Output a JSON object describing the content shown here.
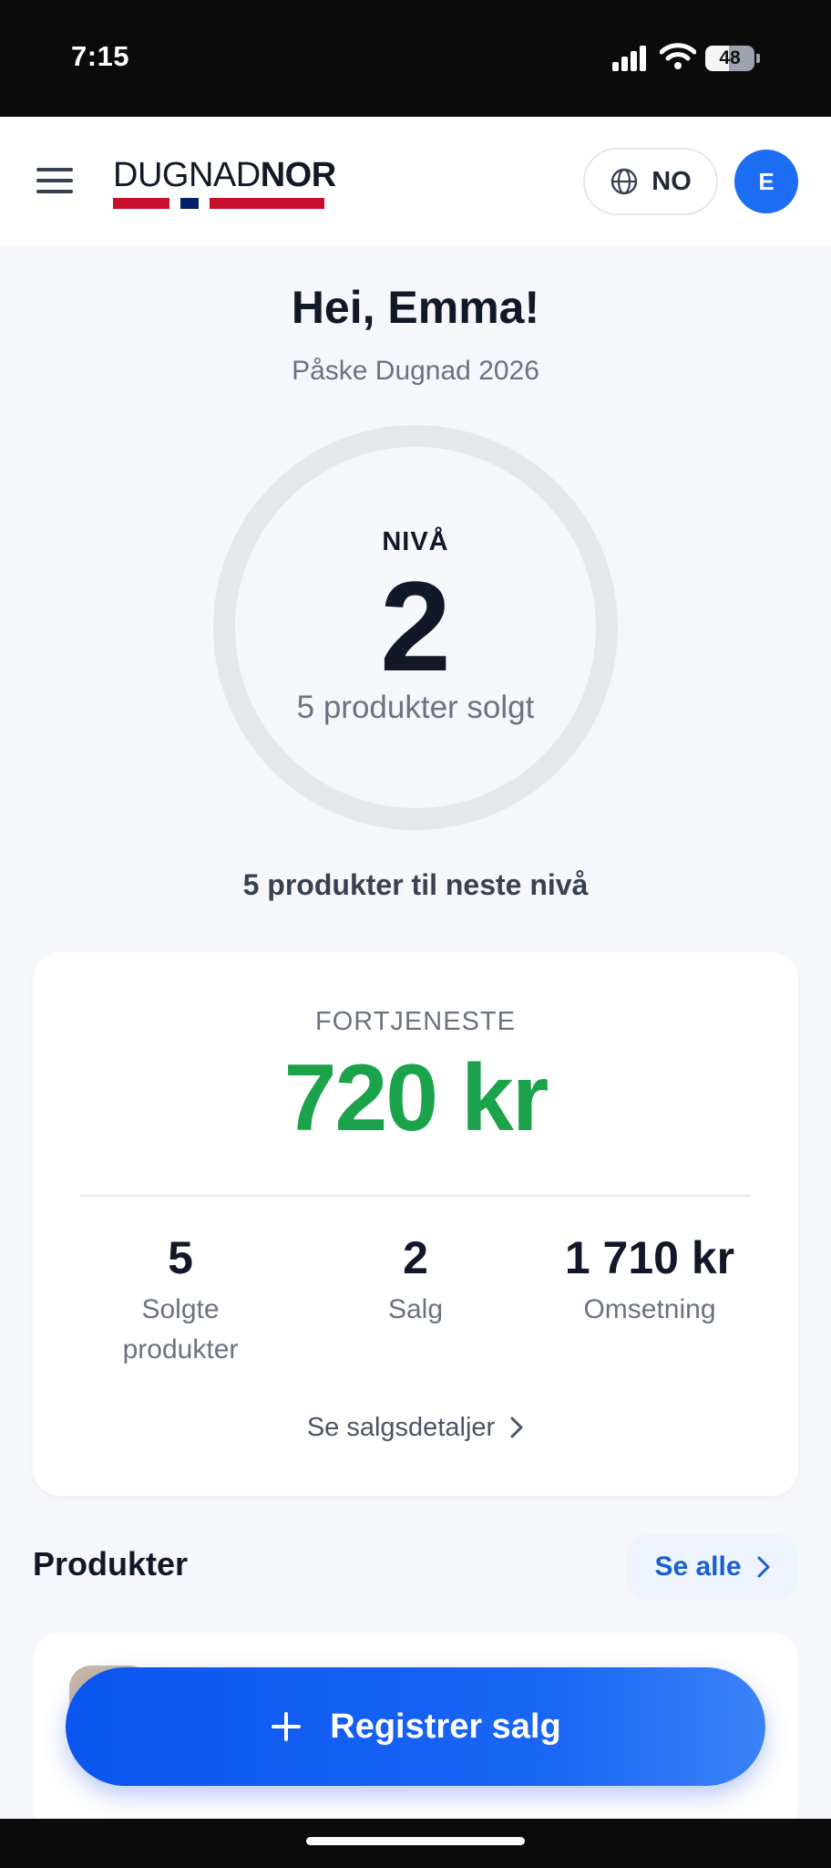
{
  "status_bar": {
    "time": "7:15",
    "battery_level": 48,
    "battery_text": "48"
  },
  "header": {
    "logo_part1": "DUGNAD",
    "logo_part2": "NOR",
    "language": "NO",
    "avatar_initial": "E",
    "colors": {
      "flag_red": "#c8102e",
      "flag_blue": "#012169",
      "avatar_bg": "#1d6df3"
    }
  },
  "greeting": {
    "title": "Hei, Emma!",
    "campaign": "Påske Dugnad 2026"
  },
  "level": {
    "caption": "NIVÅ",
    "value": "2",
    "sold_text": "5 produkter solgt",
    "next_level_text": "5 produkter til neste nivå",
    "progress": 0
  },
  "earnings": {
    "label": "FORTJENESTE",
    "value": "720 kr",
    "stats": [
      {
        "value": "5",
        "label": "Solgte produkter"
      },
      {
        "value": "2",
        "label": "Salg"
      },
      {
        "value": "1 710 kr",
        "label": "Omsetning"
      }
    ],
    "details_link": "Se salgsdetaljer"
  },
  "products": {
    "title": "Produkter",
    "see_all": "Se alle"
  },
  "actions": {
    "register_sale": "Registrer salg"
  },
  "colors": {
    "accent": "#1a66f5",
    "earnings_green": "#1aa34a",
    "text_primary": "#111827"
  }
}
